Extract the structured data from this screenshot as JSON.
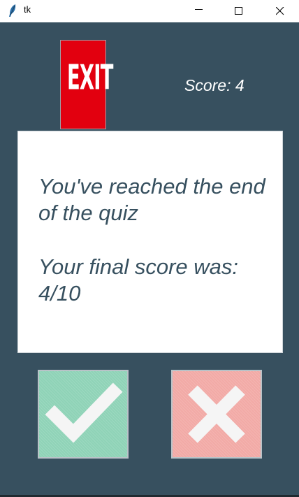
{
  "window": {
    "title": "tk",
    "icons": {
      "app": "feather-icon",
      "minimize": "minimize-icon",
      "maximize": "maximize-icon",
      "close": "close-icon"
    }
  },
  "quiz": {
    "exit_label": "EXIT",
    "score_label": "Score: 4",
    "message_line1": "You've reached the end of the quiz",
    "message_line2": "Your final score was: 4/10",
    "true_icon": "checkmark-icon",
    "false_icon": "cross-icon"
  },
  "colors": {
    "background": "#37505f",
    "exit_red": "#e2000f",
    "true_green": "#8fd3b7",
    "false_red": "#f2aaa6",
    "text_dark": "#37505f"
  }
}
